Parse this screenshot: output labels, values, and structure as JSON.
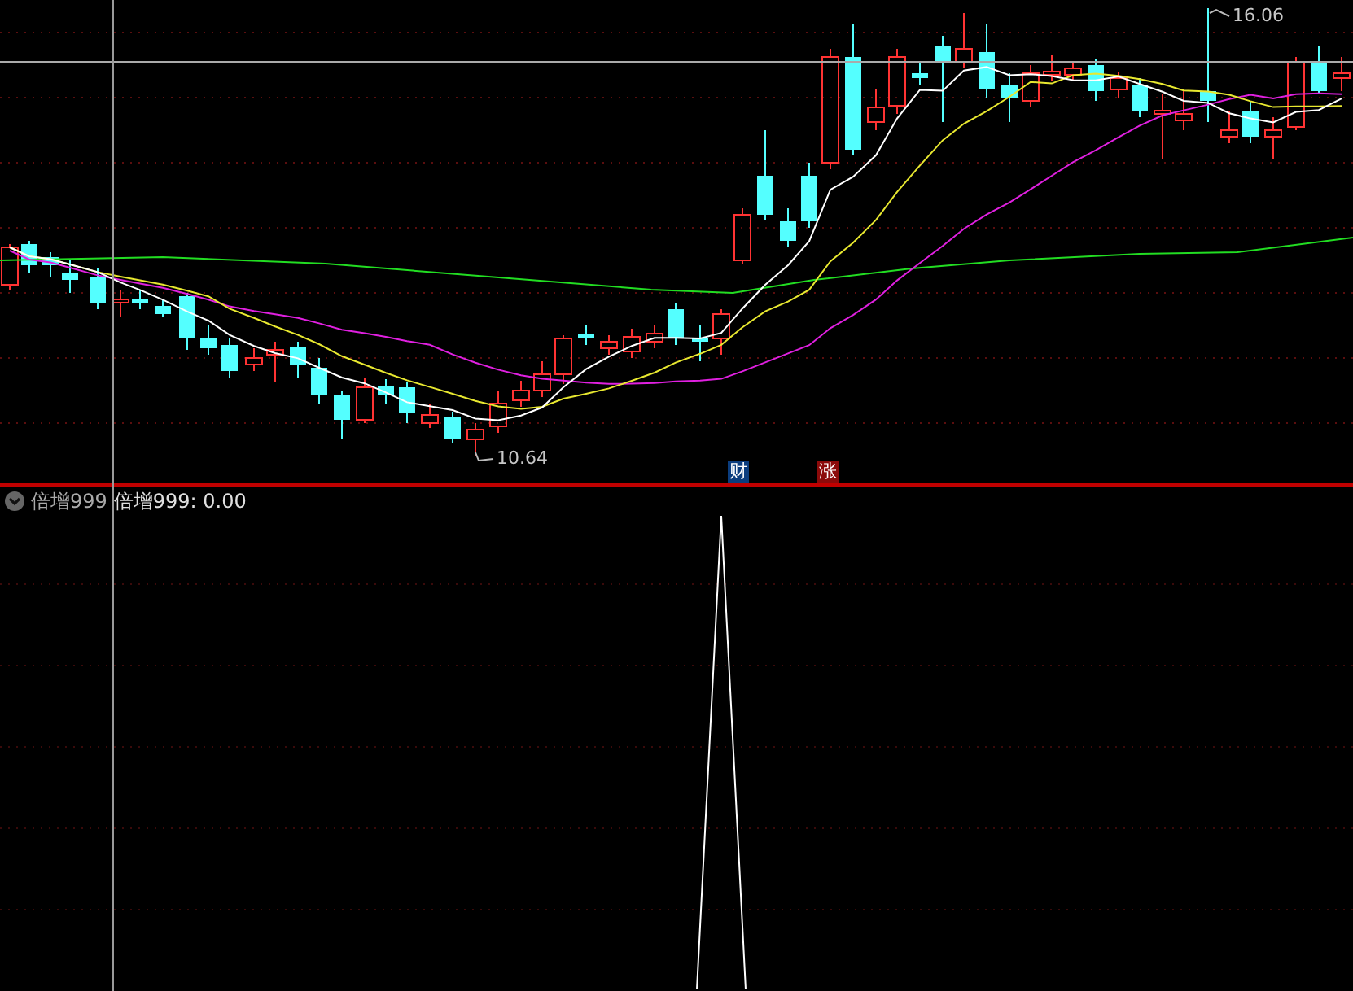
{
  "upper_chart": {
    "high_label": "16.06",
    "low_label": "10.64",
    "markers": [
      {
        "text": "财",
        "color": "#0b3d7e"
      },
      {
        "text": "涨",
        "color": "#8c0a0a"
      }
    ]
  },
  "indicator_panel": {
    "name": "倍增999",
    "reading": "倍增999: 0.00"
  }
}
